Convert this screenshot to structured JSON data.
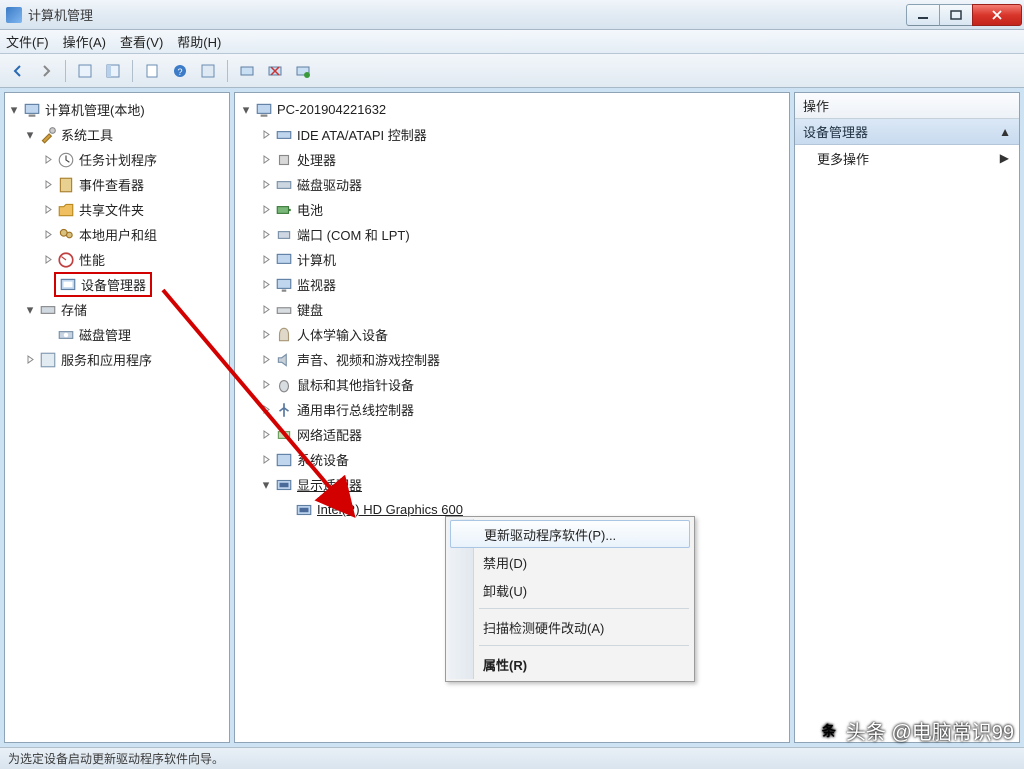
{
  "window": {
    "title": "计算机管理"
  },
  "menu": {
    "file": "文件(F)",
    "action": "操作(A)",
    "view": "查看(V)",
    "help": "帮助(H)"
  },
  "left_tree": {
    "root": "计算机管理(本地)",
    "systools": "系统工具",
    "task_scheduler": "任务计划程序",
    "event_viewer": "事件查看器",
    "shared_folders": "共享文件夹",
    "local_users": "本地用户和组",
    "performance": "性能",
    "device_manager": "设备管理器",
    "storage": "存储",
    "disk_mgmt": "磁盘管理",
    "services_apps": "服务和应用程序"
  },
  "mid_tree": {
    "pc": "PC-201904221632",
    "ide": "IDE ATA/ATAPI 控制器",
    "processors": "处理器",
    "disk_drives": "磁盘驱动器",
    "battery": "电池",
    "ports": "端口 (COM 和 LPT)",
    "computer": "计算机",
    "monitor": "监视器",
    "keyboard": "键盘",
    "hid": "人体学输入设备",
    "sound": "声音、视频和游戏控制器",
    "mouse": "鼠标和其他指针设备",
    "usb": "通用串行总线控制器",
    "network": "网络适配器",
    "system_devices": "系统设备",
    "display_adapters": "显示适配器",
    "intel_hd": "Intel(R) HD Graphics 600"
  },
  "context_menu": {
    "update_driver": "更新驱动程序软件(P)...",
    "disable": "禁用(D)",
    "uninstall": "卸载(U)",
    "scan_hw": "扫描检测硬件改动(A)",
    "properties": "属性(R)"
  },
  "actions": {
    "header": "操作",
    "selected": "设备管理器",
    "more": "更多操作"
  },
  "status": "为选定设备启动更新驱动程序软件向导。",
  "watermark": "头条 @电脑常识99"
}
